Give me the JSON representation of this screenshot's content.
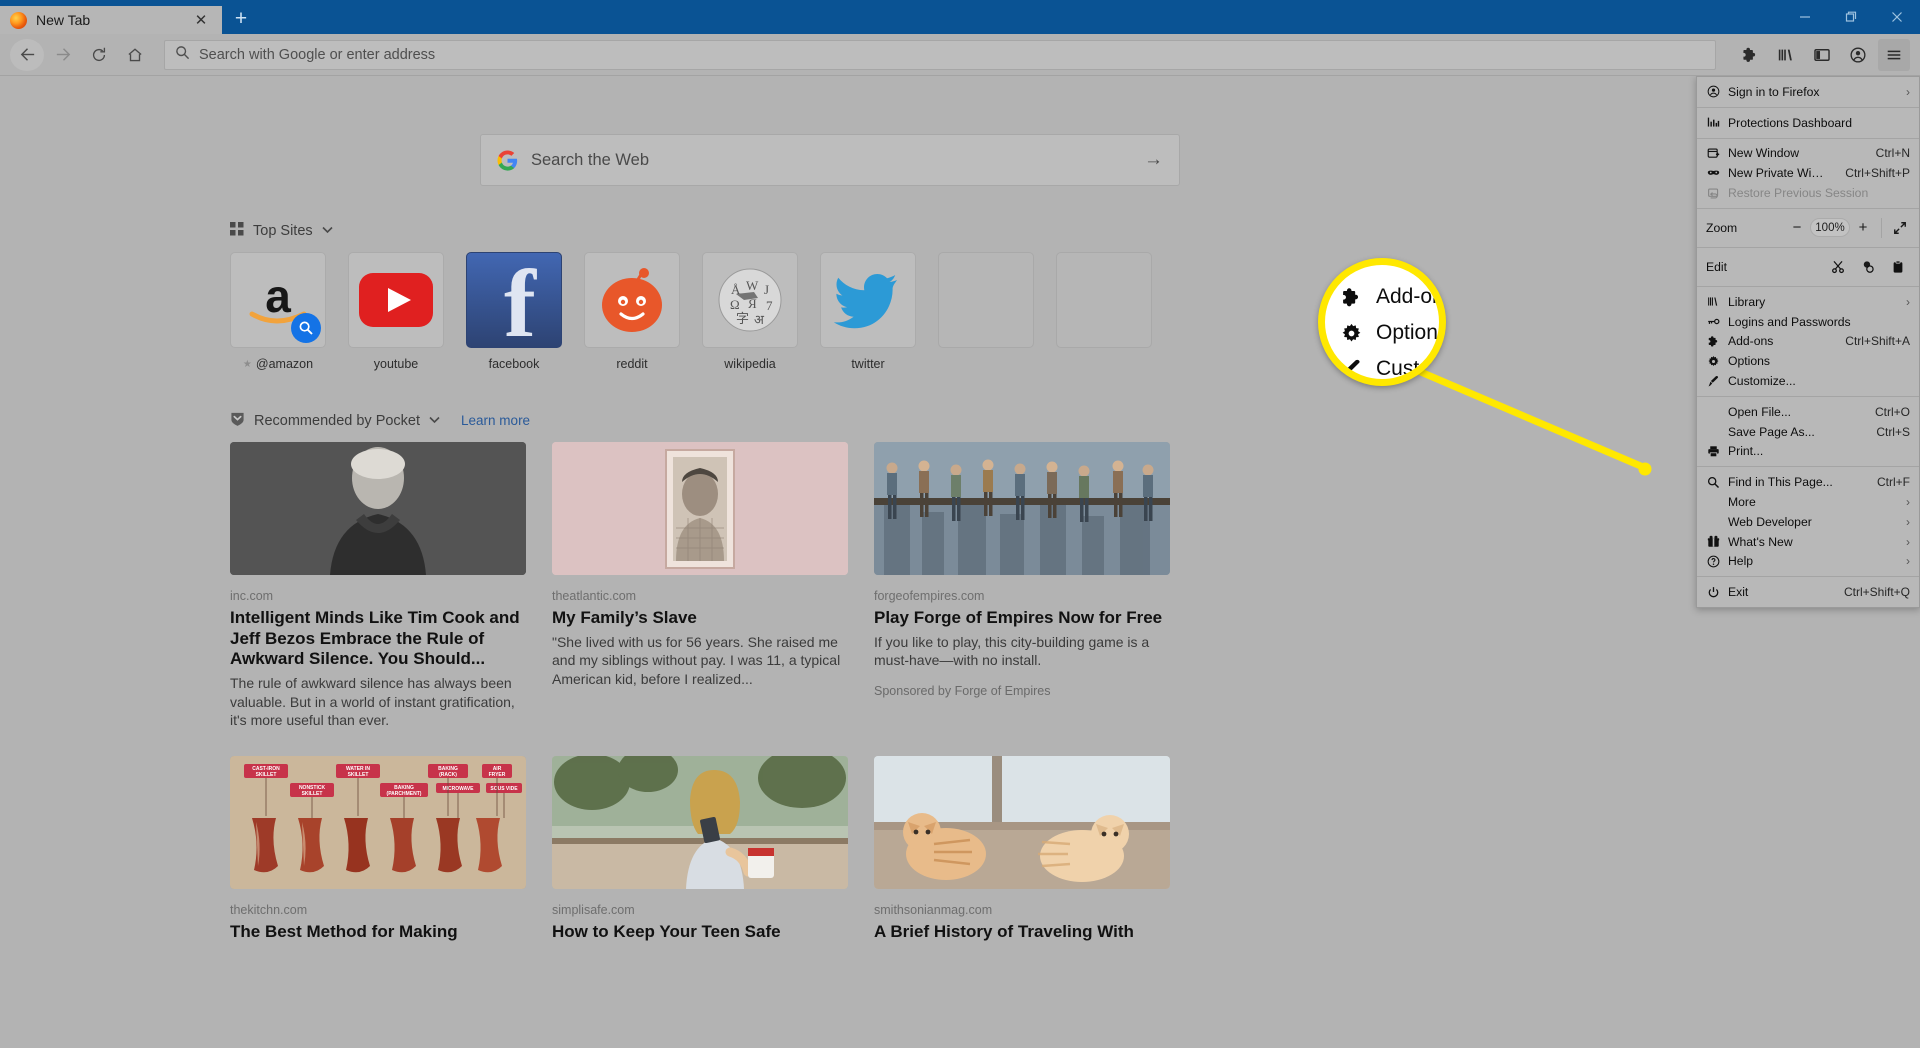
{
  "window": {
    "controls": {
      "minimize": "minimize-icon",
      "maximize": "maximize-icon",
      "close": "close-icon"
    }
  },
  "tabs": [
    {
      "title": "New Tab",
      "favicon": "firefox-icon",
      "close_label": "✕"
    }
  ],
  "newtab_button": "+",
  "navbar": {
    "back": "back-arrow-icon",
    "forward": "forward-arrow-icon",
    "reload": "reload-icon",
    "home": "home-icon",
    "urlbar_placeholder": "Search with Google or enter address",
    "urlbar_value": "",
    "icons": [
      "addons-puzzle-icon",
      "library-icon",
      "sidebar-icon",
      "account-icon",
      "hamburger-menu-icon"
    ]
  },
  "newtab": {
    "search": {
      "placeholder": "Search the Web",
      "engine": "google-icon",
      "go": "→"
    },
    "topsites": {
      "heading": "Top Sites",
      "chevron": "⌄",
      "sites": [
        {
          "label": "@amazon",
          "icon": "amazon-icon",
          "pinned": true,
          "badge": "search-badge"
        },
        {
          "label": "youtube",
          "icon": "youtube-icon",
          "pinned": false
        },
        {
          "label": "facebook",
          "icon": "facebook-icon",
          "pinned": false
        },
        {
          "label": "reddit",
          "icon": "reddit-icon",
          "pinned": false
        },
        {
          "label": "wikipedia",
          "icon": "wikipedia-icon",
          "pinned": false
        },
        {
          "label": "twitter",
          "icon": "twitter-icon",
          "pinned": false
        },
        {
          "label": "",
          "icon": "empty",
          "pinned": false
        },
        {
          "label": "",
          "icon": "empty",
          "pinned": false
        }
      ]
    },
    "pocket": {
      "heading": "Recommended by Pocket",
      "chevron": "⌄",
      "learn_more": "Learn more",
      "cards": [
        {
          "domain": "inc.com",
          "title": "Intelligent Minds Like Tim Cook and Jeff Bezos Embrace the Rule of Awkward Silence. You Should...",
          "excerpt": "The rule of awkward silence has always been valuable. But in a world of instant gratification, it's more useful than ever.",
          "sponsor": "",
          "image": "portrait-man-bw"
        },
        {
          "domain": "theatlantic.com",
          "title": "My Family’s Slave",
          "excerpt": "\"She lived with us for 56 years. She raised me and my siblings without pay. I was 11, a typical American kid, before I realized...",
          "sponsor": "",
          "image": "vintage-portrait-pink"
        },
        {
          "domain": "forgeofempires.com",
          "title": "Play Forge of Empires Now for Free",
          "excerpt": "If you like to play, this city-building game is a must-have—with no install.",
          "sponsor": "Sponsored by Forge of Empires",
          "image": "workers-on-beam"
        },
        {
          "domain": "thekitchn.com",
          "title": "The Best Method for Making",
          "excerpt": "",
          "sponsor": "",
          "image": "bacon-methods",
          "image_labels": [
            "CAST-IRON SKILLET",
            "NONSTICK SKILLET",
            "WATER IN SKILLET",
            "BAKING (PARCHMENT)",
            "BAKING (RACK)",
            "MICROWAVE",
            "AIR FRYER",
            "SOUS VIDE"
          ]
        },
        {
          "domain": "simplisafe.com",
          "title": "How to Keep Your Teen Safe",
          "excerpt": "",
          "sponsor": "",
          "image": "woman-with-phone-cafe"
        },
        {
          "domain": "smithsonianmag.com",
          "title": "A Brief History of Traveling With",
          "excerpt": "",
          "sponsor": "",
          "image": "cats-by-window"
        }
      ]
    }
  },
  "appmenu": {
    "groups": [
      {
        "items": [
          {
            "label": "Sign in to Firefox",
            "icon": "account-circle-icon",
            "shortcut": "",
            "arrow": "›",
            "disabled": false
          }
        ]
      },
      {
        "items": [
          {
            "label": "Protections Dashboard",
            "icon": "protections-chart-icon",
            "shortcut": "",
            "arrow": "",
            "disabled": false
          }
        ]
      },
      {
        "items": [
          {
            "label": "New Window",
            "icon": "new-window-icon",
            "shortcut": "Ctrl+N",
            "arrow": "",
            "disabled": false
          },
          {
            "label": "New Private Window",
            "icon": "private-window-mask-icon",
            "shortcut": "Ctrl+Shift+P",
            "arrow": "",
            "disabled": false
          },
          {
            "label": "Restore Previous Session",
            "icon": "restore-session-icon",
            "shortcut": "",
            "arrow": "",
            "disabled": true
          }
        ]
      }
    ],
    "zoom": {
      "label": "Zoom",
      "minus": "−",
      "value": "100%",
      "plus": "+",
      "fullscreen": "fullscreen-icon"
    },
    "edit": {
      "label": "Edit",
      "cut": "cut-scissors-icon",
      "copy": "copy-icon",
      "paste": "paste-clipboard-icon"
    },
    "groups2": [
      {
        "items": [
          {
            "label": "Library",
            "icon": "library-icon",
            "shortcut": "",
            "arrow": "›",
            "disabled": false
          },
          {
            "label": "Logins and Passwords",
            "icon": "key-icon",
            "shortcut": "",
            "arrow": "",
            "disabled": false
          },
          {
            "label": "Add-ons",
            "icon": "addons-puzzle-icon",
            "shortcut": "Ctrl+Shift+A",
            "arrow": "",
            "disabled": false
          },
          {
            "label": "Options",
            "icon": "gear-icon",
            "shortcut": "",
            "arrow": "",
            "disabled": false
          },
          {
            "label": "Customize...",
            "icon": "paintbrush-icon",
            "shortcut": "",
            "arrow": "",
            "disabled": false
          }
        ]
      },
      {
        "items": [
          {
            "label": "Open File...",
            "icon": "",
            "shortcut": "Ctrl+O",
            "arrow": "",
            "disabled": false
          },
          {
            "label": "Save Page As...",
            "icon": "",
            "shortcut": "Ctrl+S",
            "arrow": "",
            "disabled": false
          },
          {
            "label": "Print...",
            "icon": "printer-icon",
            "shortcut": "",
            "arrow": "",
            "disabled": false
          }
        ]
      },
      {
        "items": [
          {
            "label": "Find in This Page...",
            "icon": "search-icon",
            "shortcut": "Ctrl+F",
            "arrow": "",
            "disabled": false
          },
          {
            "label": "More",
            "icon": "",
            "shortcut": "",
            "arrow": "›",
            "disabled": false
          },
          {
            "label": "Web Developer",
            "icon": "",
            "shortcut": "",
            "arrow": "›",
            "disabled": false
          },
          {
            "label": "What's New",
            "icon": "gift-icon",
            "shortcut": "",
            "arrow": "›",
            "disabled": false
          },
          {
            "label": "Help",
            "icon": "help-circle-icon",
            "shortcut": "",
            "arrow": "›",
            "disabled": false
          }
        ]
      },
      {
        "items": [
          {
            "label": "Exit",
            "icon": "power-icon",
            "shortcut": "Ctrl+Shift+Q",
            "arrow": "",
            "disabled": false
          }
        ]
      }
    ]
  },
  "callout": {
    "highlight_color": "#ffe800",
    "items": [
      {
        "label": "Add-on.",
        "icon": "addons-puzzle-icon"
      },
      {
        "label": "Options",
        "icon": "gear-icon"
      },
      {
        "label": "Customi",
        "icon": "paintbrush-icon"
      }
    ]
  }
}
